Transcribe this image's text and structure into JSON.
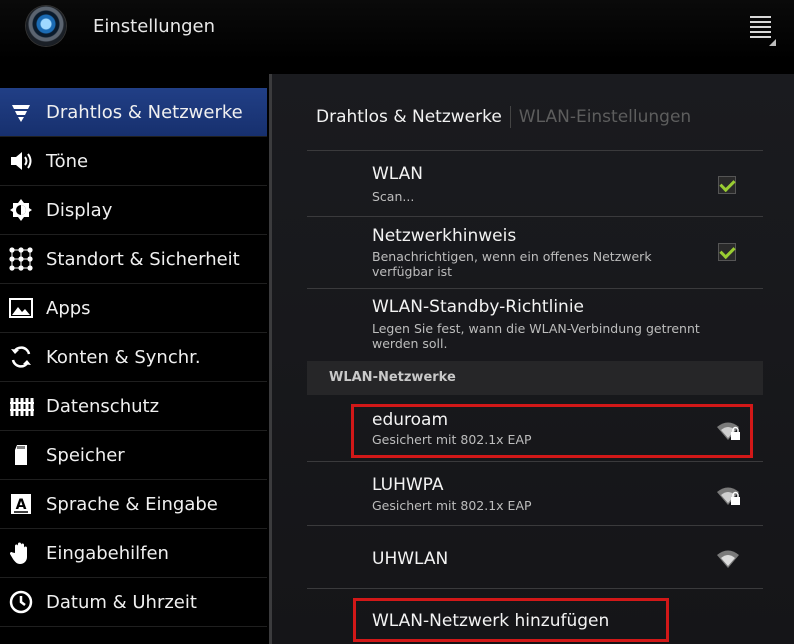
{
  "header": {
    "title": "Einstellungen",
    "logo": "settings-globe-icon",
    "menu": "overflow-menu-icon"
  },
  "sidebar": {
    "items": [
      {
        "label": "Drahtlos & Netzwerke",
        "icon": "wifi-icon",
        "active": true
      },
      {
        "label": "Töne",
        "icon": "speaker-icon"
      },
      {
        "label": "Display",
        "icon": "brightness-icon"
      },
      {
        "label": "Standort & Sicherheit",
        "icon": "grid-dots-icon"
      },
      {
        "label": "Apps",
        "icon": "apps-icon"
      },
      {
        "label": "Konten & Synchr.",
        "icon": "sync-icon"
      },
      {
        "label": "Datenschutz",
        "icon": "privacy-icon"
      },
      {
        "label": "Speicher",
        "icon": "sdcard-icon"
      },
      {
        "label": "Sprache & Eingabe",
        "icon": "keyboard-a-icon"
      },
      {
        "label": "Eingabehilfen",
        "icon": "hand-icon"
      },
      {
        "label": "Datum & Uhrzeit",
        "icon": "clock-icon"
      }
    ]
  },
  "main": {
    "breadcrumb": {
      "current": "Drahtlos & Netzwerke",
      "sub": "WLAN-Einstellungen"
    },
    "prefs": [
      {
        "title": "WLAN",
        "summary": "Scan...",
        "checked": true
      },
      {
        "title": "Netzwerkhinweis",
        "summary": "Benachrichtigen, wenn ein offenes Netzwerk verfügbar ist",
        "checked": true
      },
      {
        "title": "WLAN-Standby-Richtlinie",
        "summary": "Legen Sie fest, wann die WLAN-Verbindung getrennt werden soll."
      }
    ],
    "section": "WLAN-Netzwerke",
    "networks": [
      {
        "name": "eduroam",
        "security": "Gesichert mit 802.1x EAP",
        "icon": "wifi-lock-icon"
      },
      {
        "name": "LUHWPA",
        "security": "Gesichert mit 802.1x EAP",
        "icon": "wifi-lock-icon"
      },
      {
        "name": "UHWLAN",
        "security": "",
        "icon": "wifi-icon"
      }
    ],
    "add_network": "WLAN-Netzwerk hinzufügen"
  },
  "colors": {
    "accent": "#1f3a80",
    "check": "#9acd32",
    "highlight": "#d21818"
  }
}
